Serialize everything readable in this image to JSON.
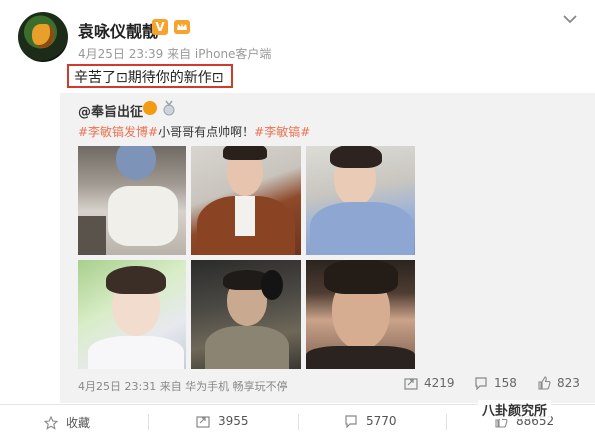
{
  "post": {
    "username": "袁咏仪靓靓",
    "vip_badge": "V",
    "meta": "4月25日 23:39 来自 iPhone客户端",
    "text": "辛苦了⊡期待你的新作⊡"
  },
  "repost": {
    "author": "@奉旨出征",
    "text_tag1": "#李敏镐发博#",
    "text_plain": "小哥哥有点帅啊！",
    "text_tag2": "#李敏镐#",
    "meta": "4月25日 23:31 来自 华为手机 畅享玩不停",
    "reposts": "4219",
    "comments": "158",
    "likes": "823"
  },
  "actions": {
    "favorite_label": "收藏",
    "repost_count": "3955",
    "comment_count": "5770",
    "like_count": "88652"
  },
  "watermark": "八卦颜究所",
  "icons": {
    "chevron": "chevron-down-icon",
    "repost": "repost-icon",
    "comment": "comment-icon",
    "like": "thumbs-up-icon",
    "favorite": "star-icon"
  },
  "colors": {
    "highlight_box": "#d23a2e",
    "tag": "#eb7350",
    "vip": "#f7a22a"
  }
}
